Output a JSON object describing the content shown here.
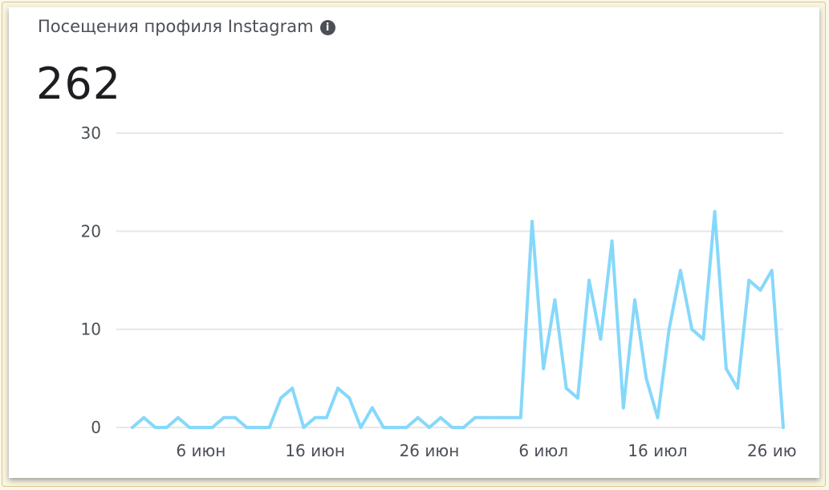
{
  "card": {
    "title": "Посещения профиля Instagram",
    "info_icon": "info-icon",
    "info_glyph": "i",
    "total": "262"
  },
  "chart_data": {
    "type": "line",
    "title": "Посещения профиля Instagram",
    "xlabel": "",
    "ylabel": "",
    "x": [
      "2020-05-31",
      "2020-06-01",
      "2020-06-02",
      "2020-06-03",
      "2020-06-04",
      "2020-06-05",
      "2020-06-06",
      "2020-06-07",
      "2020-06-08",
      "2020-06-09",
      "2020-06-10",
      "2020-06-11",
      "2020-06-12",
      "2020-06-13",
      "2020-06-14",
      "2020-06-15",
      "2020-06-16",
      "2020-06-17",
      "2020-06-18",
      "2020-06-19",
      "2020-06-20",
      "2020-06-21",
      "2020-06-22",
      "2020-06-23",
      "2020-06-24",
      "2020-06-25",
      "2020-06-26",
      "2020-06-27",
      "2020-06-28",
      "2020-06-29",
      "2020-06-30",
      "2020-07-01",
      "2020-07-02",
      "2020-07-03",
      "2020-07-04",
      "2020-07-05",
      "2020-07-06",
      "2020-07-07",
      "2020-07-08",
      "2020-07-09",
      "2020-07-10",
      "2020-07-11",
      "2020-07-12",
      "2020-07-13",
      "2020-07-14",
      "2020-07-15",
      "2020-07-16",
      "2020-07-17",
      "2020-07-18",
      "2020-07-19",
      "2020-07-20",
      "2020-07-21",
      "2020-07-22",
      "2020-07-23",
      "2020-07-24",
      "2020-07-25",
      "2020-07-26",
      "2020-07-27"
    ],
    "series": [
      {
        "values": [
          0,
          1,
          0,
          0,
          1,
          0,
          0,
          0,
          1,
          1,
          0,
          0,
          0,
          3,
          4,
          0,
          1,
          1,
          4,
          3,
          0,
          2,
          0,
          0,
          0,
          1,
          0,
          1,
          0,
          0,
          1,
          1,
          1,
          1,
          1,
          21,
          6,
          13,
          4,
          3,
          15,
          9,
          19,
          2,
          13,
          5,
          1,
          10,
          16,
          10,
          9,
          22,
          6,
          4,
          15,
          14,
          16,
          0
        ],
        "color": "#86d8fb"
      }
    ],
    "yticks": [
      "0",
      "10",
      "20",
      "30"
    ],
    "ylim": [
      0,
      30
    ],
    "xticks": [
      {
        "date": "2020-06-06",
        "label": "6 июн"
      },
      {
        "date": "2020-06-16",
        "label": "16 июн"
      },
      {
        "date": "2020-06-26",
        "label": "26 июн"
      },
      {
        "date": "2020-07-06",
        "label": "6 июл"
      },
      {
        "date": "2020-07-16",
        "label": "16 июл"
      },
      {
        "date": "2020-07-26",
        "label": "26 ию"
      }
    ],
    "grid": true,
    "legend": "none"
  }
}
